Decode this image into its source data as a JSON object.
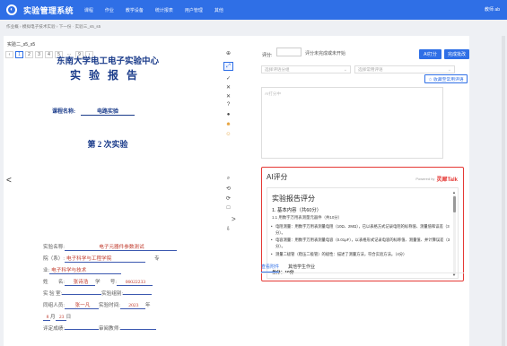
{
  "header": {
    "app_title": "实验管理系统",
    "nav": [
      "课程",
      "作业",
      "教学设备",
      "统计报表",
      "用户管理",
      "其他"
    ],
    "user": "教师 ab"
  },
  "breadcrumb": "作业概 › 模拟电子技术实验 › 下一份 · 实验三_s5_s5",
  "doc": {
    "filename": "实验二_s5_s5",
    "pages": [
      "‹",
      "1",
      "2",
      "3",
      "4",
      "5",
      "···",
      "9",
      "›"
    ],
    "center": "东南大学电工电子实验中心",
    "report_title": "实验报告",
    "course_label": "课程名称:",
    "course_value": "电路实验",
    "times": "第 2 次实验",
    "prev_arrow": "<",
    "next_arrow": ">",
    "exp_name_label": "实验名称:",
    "exp_name": "电子元器件参数测试",
    "dept_label": "院（系）:",
    "dept": "电子科学与工程学院",
    "major_label": "专",
    "major2_label": "业:",
    "major": "电子科学与技术",
    "name_label": "姓　　名:",
    "name": "张诗浩",
    "id_label": "学　　号:",
    "id": "06022233",
    "room_label": "实 验 室:",
    "group_label": "实验组别:",
    "partner_label": "同组人员:",
    "partner": "张一凡",
    "time_label": "实验时间:",
    "year": "2023",
    "year_label": "年",
    "month": "8",
    "month_label": "月",
    "day": "23",
    "day_label": "日",
    "score_label": "评定成绩:",
    "reviewer_label": "审阅教师:"
  },
  "tools": [
    "⊕",
    "⤢",
    "✓",
    "✕",
    "✕",
    "?",
    "●",
    "☻",
    "☺",
    "⌕",
    "⟲",
    "⟳",
    "□",
    "⇩"
  ],
  "grading": {
    "score_label": "评分:",
    "score_value": "",
    "score_hint": "评分未完成或未开始",
    "ai_btn": "AI打分",
    "done_btn": "完成批改",
    "select1": "选择评语分组",
    "select2": "选择常用评语",
    "save_btn": "☆ 收藏至常用评语",
    "comment_placeholder": "AI打分中"
  },
  "ai": {
    "title": "AI评分",
    "powered": "Powered by",
    "brand": "灵犀Talk",
    "heading": "实验报告评分",
    "section": "1. 基本内容（共60分）",
    "sub": "1.1 用数字万用表测量元器件（共10分）",
    "items": [
      "电阻测量：用数字万用表测量电阻（10Ω、2MΩ），已以表格方式记录电阻的标称值、测量值和误差（3分）。",
      "电容测量：用数字万用表测量电容（0.01μF），以表格形式记录电容的标称值、测量值、并计算误差（3分）。",
      "测量二极管（稳压二极管）的极性：描述了测量方法，符合实验方法。（4分）"
    ],
    "total": "总分：10分"
  },
  "tabs": [
    "查看附件",
    "其他学生作业"
  ]
}
